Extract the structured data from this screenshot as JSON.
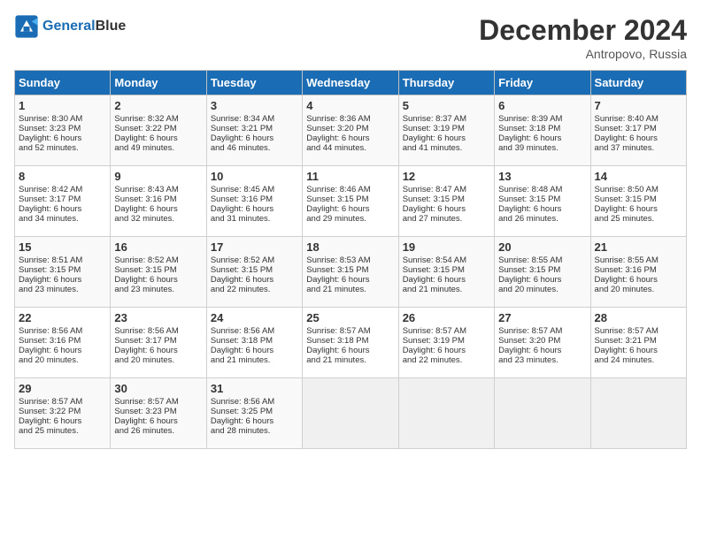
{
  "header": {
    "logo_line1": "General",
    "logo_line2": "Blue",
    "month_title": "December 2024",
    "subtitle": "Antropovo, Russia"
  },
  "days_of_week": [
    "Sunday",
    "Monday",
    "Tuesday",
    "Wednesday",
    "Thursday",
    "Friday",
    "Saturday"
  ],
  "weeks": [
    [
      {
        "day": "1",
        "info": "Sunrise: 8:30 AM\nSunset: 3:23 PM\nDaylight: 6 hours\nand 52 minutes."
      },
      {
        "day": "2",
        "info": "Sunrise: 8:32 AM\nSunset: 3:22 PM\nDaylight: 6 hours\nand 49 minutes."
      },
      {
        "day": "3",
        "info": "Sunrise: 8:34 AM\nSunset: 3:21 PM\nDaylight: 6 hours\nand 46 minutes."
      },
      {
        "day": "4",
        "info": "Sunrise: 8:36 AM\nSunset: 3:20 PM\nDaylight: 6 hours\nand 44 minutes."
      },
      {
        "day": "5",
        "info": "Sunrise: 8:37 AM\nSunset: 3:19 PM\nDaylight: 6 hours\nand 41 minutes."
      },
      {
        "day": "6",
        "info": "Sunrise: 8:39 AM\nSunset: 3:18 PM\nDaylight: 6 hours\nand 39 minutes."
      },
      {
        "day": "7",
        "info": "Sunrise: 8:40 AM\nSunset: 3:17 PM\nDaylight: 6 hours\nand 37 minutes."
      }
    ],
    [
      {
        "day": "8",
        "info": "Sunrise: 8:42 AM\nSunset: 3:17 PM\nDaylight: 6 hours\nand 34 minutes."
      },
      {
        "day": "9",
        "info": "Sunrise: 8:43 AM\nSunset: 3:16 PM\nDaylight: 6 hours\nand 32 minutes."
      },
      {
        "day": "10",
        "info": "Sunrise: 8:45 AM\nSunset: 3:16 PM\nDaylight: 6 hours\nand 31 minutes."
      },
      {
        "day": "11",
        "info": "Sunrise: 8:46 AM\nSunset: 3:15 PM\nDaylight: 6 hours\nand 29 minutes."
      },
      {
        "day": "12",
        "info": "Sunrise: 8:47 AM\nSunset: 3:15 PM\nDaylight: 6 hours\nand 27 minutes."
      },
      {
        "day": "13",
        "info": "Sunrise: 8:48 AM\nSunset: 3:15 PM\nDaylight: 6 hours\nand 26 minutes."
      },
      {
        "day": "14",
        "info": "Sunrise: 8:50 AM\nSunset: 3:15 PM\nDaylight: 6 hours\nand 25 minutes."
      }
    ],
    [
      {
        "day": "15",
        "info": "Sunrise: 8:51 AM\nSunset: 3:15 PM\nDaylight: 6 hours\nand 23 minutes."
      },
      {
        "day": "16",
        "info": "Sunrise: 8:52 AM\nSunset: 3:15 PM\nDaylight: 6 hours\nand 23 minutes."
      },
      {
        "day": "17",
        "info": "Sunrise: 8:52 AM\nSunset: 3:15 PM\nDaylight: 6 hours\nand 22 minutes."
      },
      {
        "day": "18",
        "info": "Sunrise: 8:53 AM\nSunset: 3:15 PM\nDaylight: 6 hours\nand 21 minutes."
      },
      {
        "day": "19",
        "info": "Sunrise: 8:54 AM\nSunset: 3:15 PM\nDaylight: 6 hours\nand 21 minutes."
      },
      {
        "day": "20",
        "info": "Sunrise: 8:55 AM\nSunset: 3:15 PM\nDaylight: 6 hours\nand 20 minutes."
      },
      {
        "day": "21",
        "info": "Sunrise: 8:55 AM\nSunset: 3:16 PM\nDaylight: 6 hours\nand 20 minutes."
      }
    ],
    [
      {
        "day": "22",
        "info": "Sunrise: 8:56 AM\nSunset: 3:16 PM\nDaylight: 6 hours\nand 20 minutes."
      },
      {
        "day": "23",
        "info": "Sunrise: 8:56 AM\nSunset: 3:17 PM\nDaylight: 6 hours\nand 20 minutes."
      },
      {
        "day": "24",
        "info": "Sunrise: 8:56 AM\nSunset: 3:18 PM\nDaylight: 6 hours\nand 21 minutes."
      },
      {
        "day": "25",
        "info": "Sunrise: 8:57 AM\nSunset: 3:18 PM\nDaylight: 6 hours\nand 21 minutes."
      },
      {
        "day": "26",
        "info": "Sunrise: 8:57 AM\nSunset: 3:19 PM\nDaylight: 6 hours\nand 22 minutes."
      },
      {
        "day": "27",
        "info": "Sunrise: 8:57 AM\nSunset: 3:20 PM\nDaylight: 6 hours\nand 23 minutes."
      },
      {
        "day": "28",
        "info": "Sunrise: 8:57 AM\nSunset: 3:21 PM\nDaylight: 6 hours\nand 24 minutes."
      }
    ],
    [
      {
        "day": "29",
        "info": "Sunrise: 8:57 AM\nSunset: 3:22 PM\nDaylight: 6 hours\nand 25 minutes."
      },
      {
        "day": "30",
        "info": "Sunrise: 8:57 AM\nSunset: 3:23 PM\nDaylight: 6 hours\nand 26 minutes."
      },
      {
        "day": "31",
        "info": "Sunrise: 8:56 AM\nSunset: 3:25 PM\nDaylight: 6 hours\nand 28 minutes."
      },
      {
        "day": "",
        "info": ""
      },
      {
        "day": "",
        "info": ""
      },
      {
        "day": "",
        "info": ""
      },
      {
        "day": "",
        "info": ""
      }
    ]
  ]
}
